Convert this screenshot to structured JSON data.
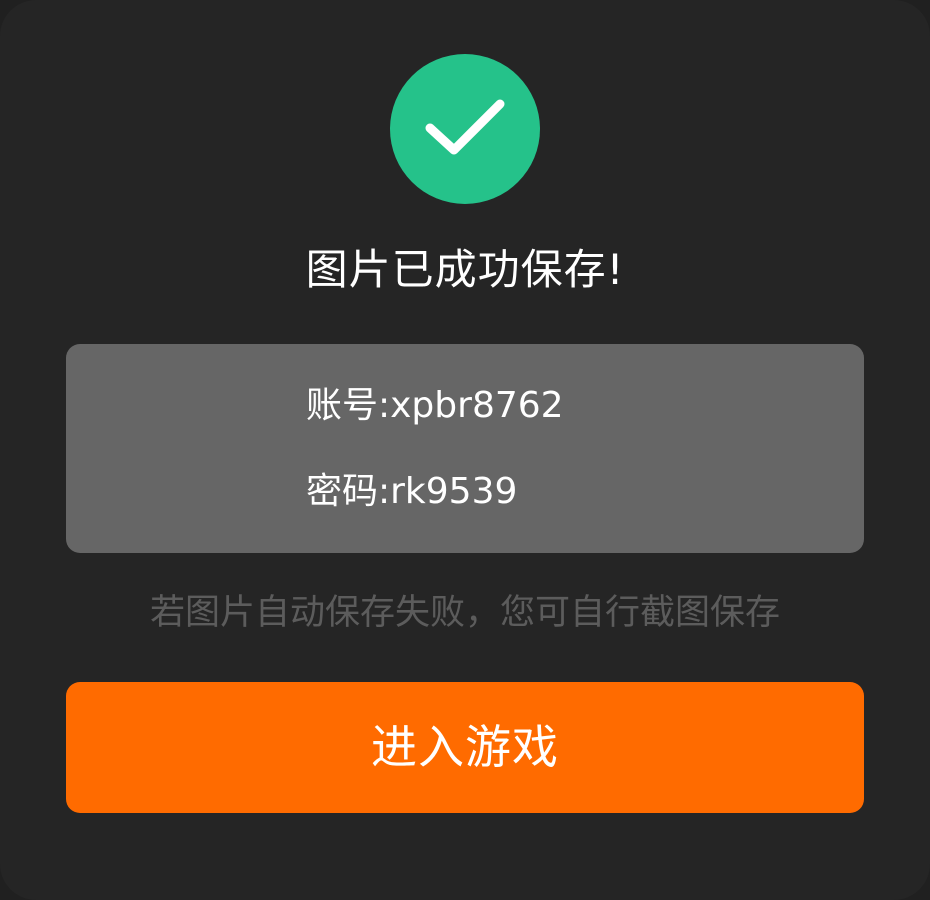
{
  "theme": {
    "dialog_bg": "#252525",
    "success_green": "#25C28A",
    "credentials_bg": "#666666",
    "accent_orange": "#FF6B00",
    "hint_text": "#5C5C5C"
  },
  "success_icon": "check-icon",
  "title": "图片已成功保存!",
  "credentials": {
    "account": "账号:xpbr8762",
    "password": "密码:rk9539"
  },
  "hint": "若图片自动保存失败，您可自行截图保存",
  "enter_button_label": "进入游戏"
}
